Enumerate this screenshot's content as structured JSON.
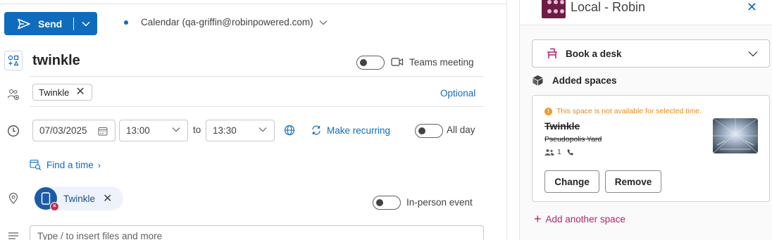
{
  "compose": {
    "send_label": "Send",
    "calendar_label": "Calendar (qa-griffin@robinpowered.com)",
    "title": "twinkle",
    "teams_meeting_label": "Teams meeting",
    "attendees": [
      {
        "name": "Twinkle"
      }
    ],
    "optional_label": "Optional",
    "start_date": "07/03/2025",
    "start_time": "13:00",
    "to_label": "to",
    "end_time": "13:30",
    "make_recurring_label": "Make recurring",
    "all_day_label": "All day",
    "find_time_label": "Find a time",
    "location": "Twinkle",
    "in_person_label": "In-person event",
    "body_placeholder": "Type / to insert files and more",
    "teams_meeting_on": false,
    "all_day_on": false,
    "in_person_on": false
  },
  "addin": {
    "title": "Local - Robin",
    "book_desk_label": "Book a desk",
    "added_spaces_label": "Added spaces",
    "space": {
      "warning": "This space is not available for selected time.",
      "name": "Twinkle",
      "location": "Pseudopolis Yard",
      "capacity": "1",
      "change_label": "Change",
      "remove_label": "Remove"
    },
    "add_another_label": "Add another space"
  },
  "colors": {
    "primary": "#0f6cbd",
    "robin_brand": "#b0266e",
    "warning": "#e8891c",
    "location_avatar": "#1d5ba8",
    "error_badge": "#c4314b"
  },
  "icons": {
    "send": "send-icon",
    "title": "title-shapes-icon",
    "attendees": "people-add-icon",
    "clock": "clock-icon",
    "calendar": "calendar-icon",
    "globe": "globe-icon",
    "recurring": "arrow-repeat-icon",
    "find_time": "calendar-search-icon",
    "location": "location-pin-icon",
    "body": "text-lines-icon",
    "teams": "video-camera-icon",
    "desk": "desk-icon",
    "added_spaces": "cube-icon"
  }
}
